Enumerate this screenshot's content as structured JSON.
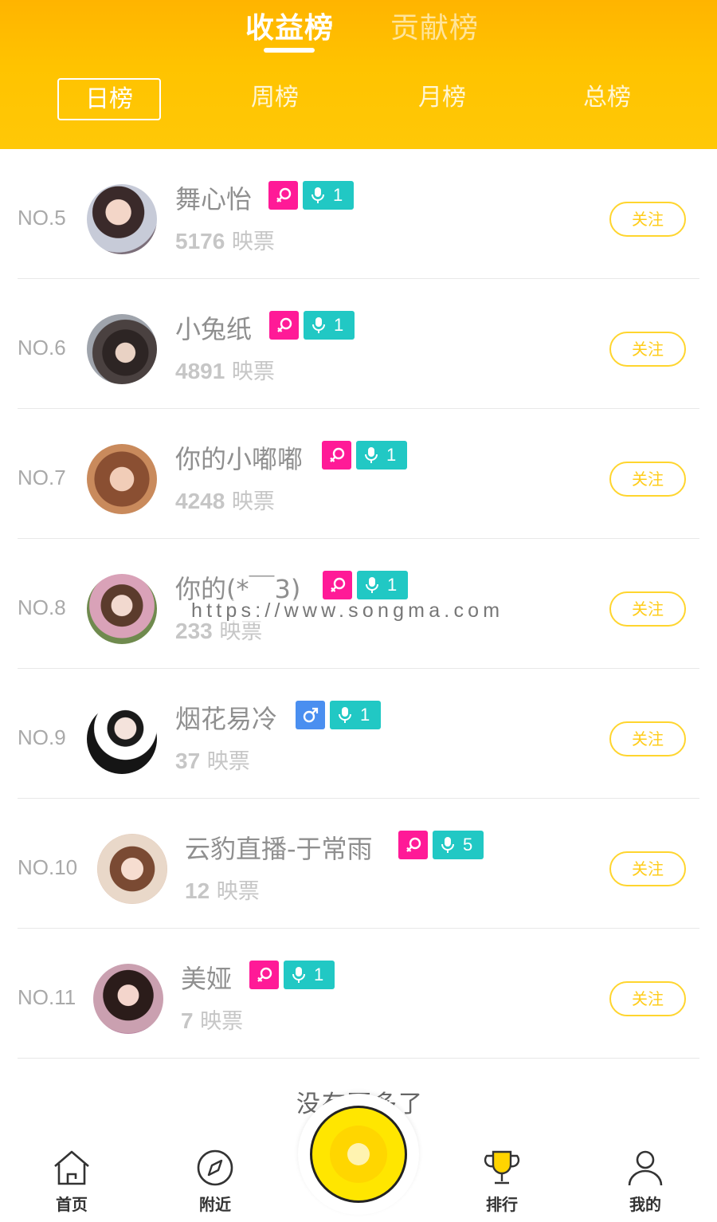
{
  "header": {
    "top_tabs": [
      "收益榜",
      "贡献榜"
    ],
    "period_tabs": [
      "日榜",
      "周榜",
      "月榜",
      "总榜"
    ]
  },
  "colors": {
    "header_yellow": "#ffc300",
    "female_badge": "#ff1a97",
    "male_badge": "#4a8ff0",
    "level_badge": "#21c8c4",
    "follow_border": "#ffd52e"
  },
  "list": {
    "items": [
      {
        "rank": "NO.5",
        "name": "舞心怡",
        "votes": "5176",
        "votes_unit": "映票",
        "gender": "female",
        "level": "1",
        "follow": "关注"
      },
      {
        "rank": "NO.6",
        "name": "小兔纸",
        "votes": "4891",
        "votes_unit": "映票",
        "gender": "female",
        "level": "1",
        "follow": "关注"
      },
      {
        "rank": "NO.7",
        "name": "你的小嘟嘟",
        "votes": "4248",
        "votes_unit": "映票",
        "gender": "female",
        "level": "1",
        "follow": "关注"
      },
      {
        "rank": "NO.8",
        "name": "你的(*￣3)",
        "votes": "233",
        "votes_unit": "映票",
        "gender": "female",
        "level": "1",
        "follow": "关注"
      },
      {
        "rank": "NO.9",
        "name": "烟花易冷",
        "votes": "37",
        "votes_unit": "映票",
        "gender": "male",
        "level": "1",
        "follow": "关注"
      },
      {
        "rank": "NO.10",
        "name": "云豹直播-于常雨",
        "votes": "12",
        "votes_unit": "映票",
        "gender": "female",
        "level": "5",
        "follow": "关注"
      },
      {
        "rank": "NO.11",
        "name": "美娅",
        "votes": "7",
        "votes_unit": "映票",
        "gender": "female",
        "level": "1",
        "follow": "关注"
      }
    ]
  },
  "watermark": "https://www.songma.com",
  "footer_text": "没有更多了",
  "bottom_nav": {
    "home": "首页",
    "nearby": "附近",
    "rank": "排行",
    "mine": "我的"
  }
}
